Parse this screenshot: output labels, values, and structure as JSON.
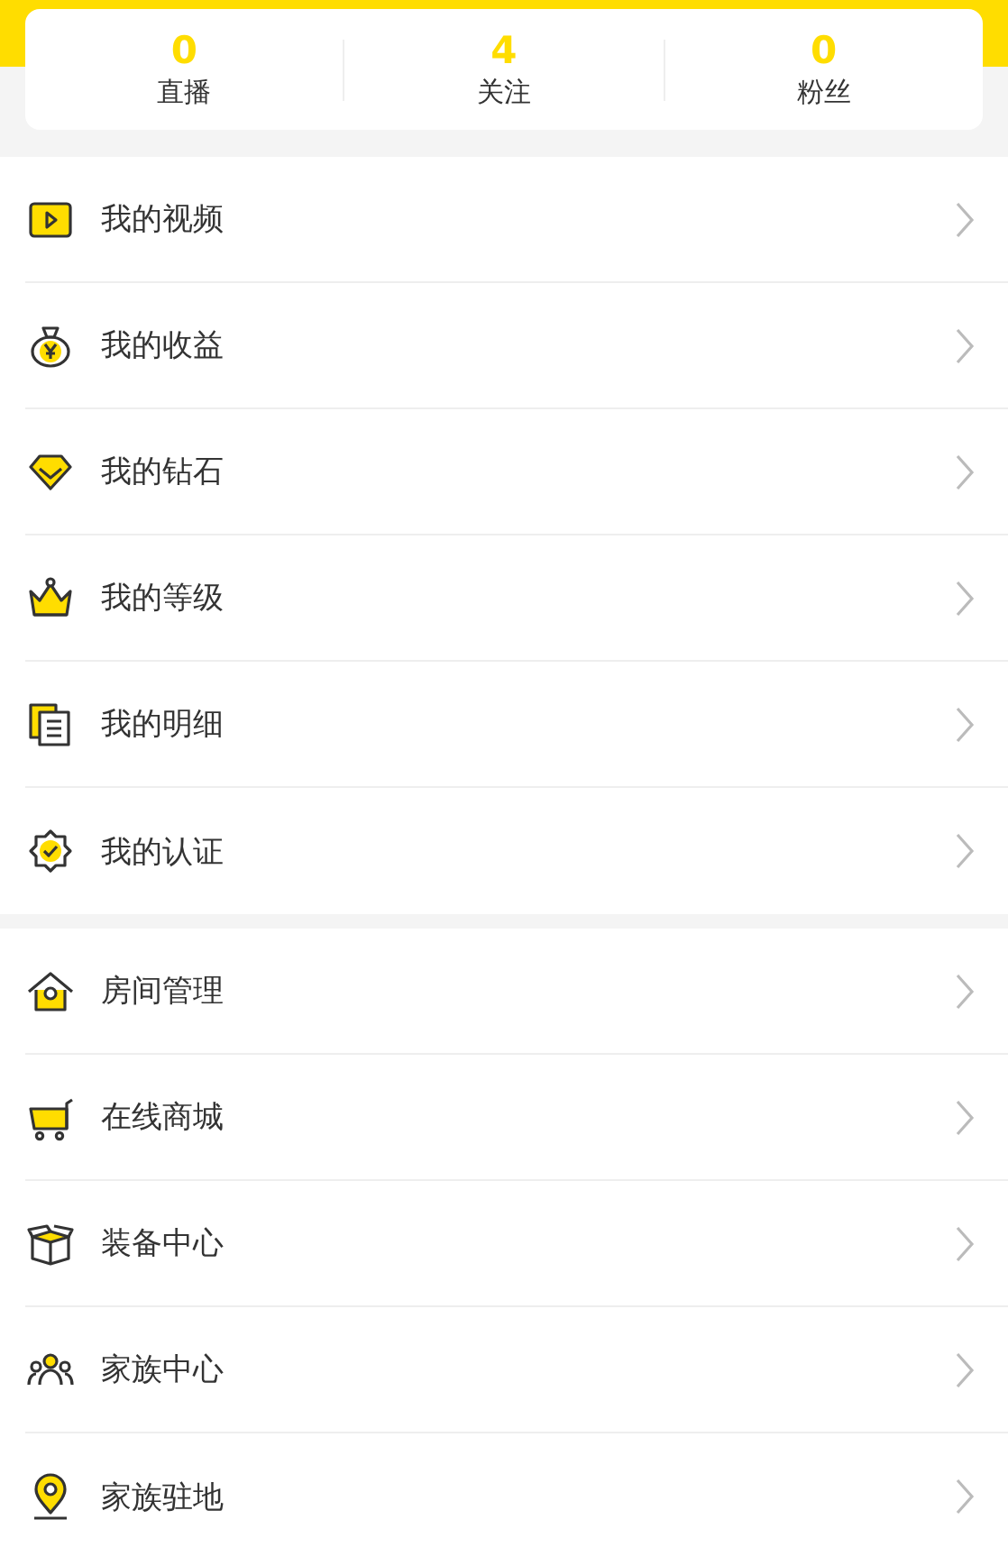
{
  "stats": [
    {
      "value": "0",
      "label": "直播"
    },
    {
      "value": "4",
      "label": "关注"
    },
    {
      "value": "0",
      "label": "粉丝"
    }
  ],
  "sections": [
    {
      "items": [
        {
          "kind": "video",
          "label": "我的视频"
        },
        {
          "kind": "moneybag",
          "label": "我的收益"
        },
        {
          "kind": "diamond",
          "label": "我的钻石"
        },
        {
          "kind": "crown",
          "label": "我的等级"
        },
        {
          "kind": "document",
          "label": "我的明细"
        },
        {
          "kind": "badge",
          "label": "我的认证"
        }
      ]
    },
    {
      "items": [
        {
          "kind": "house",
          "label": "房间管理"
        },
        {
          "kind": "cart",
          "label": "在线商城"
        },
        {
          "kind": "box",
          "label": "装备中心"
        },
        {
          "kind": "people",
          "label": "家族中心"
        },
        {
          "kind": "pin",
          "label": "家族驻地"
        }
      ]
    }
  ]
}
